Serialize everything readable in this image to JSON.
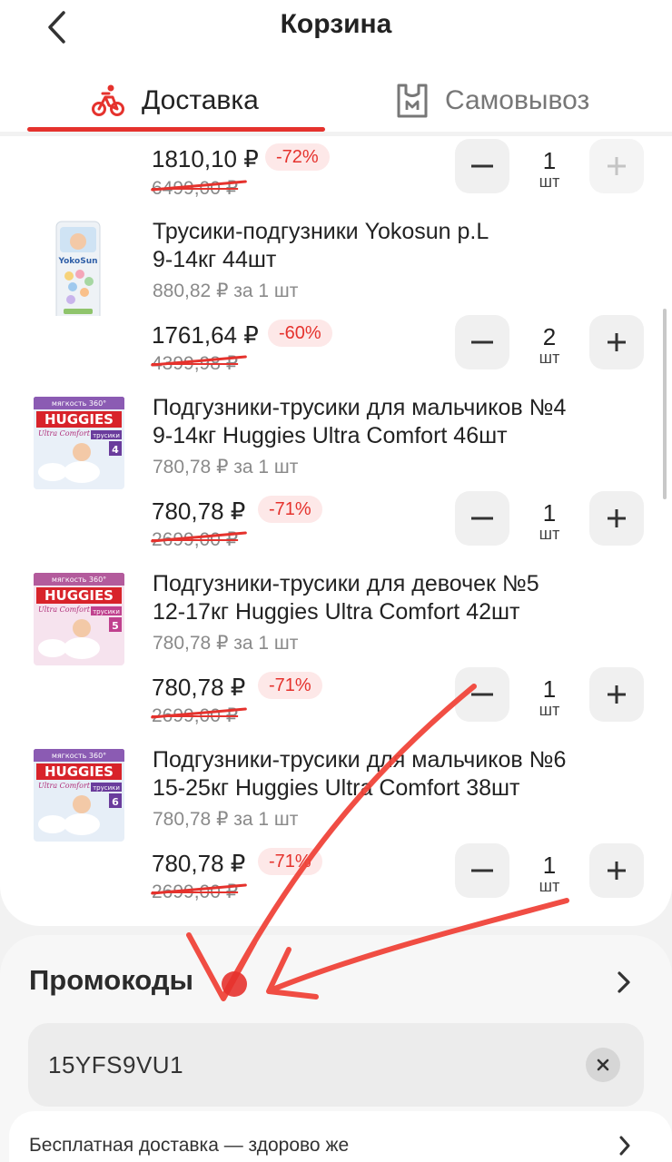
{
  "header": {
    "title": "Корзина",
    "tabs": [
      {
        "label": "Доставка",
        "active": true,
        "icon": "bike-delivery-icon"
      },
      {
        "label": "Самовывоз",
        "active": false,
        "icon": "pickup-bag-icon"
      }
    ]
  },
  "cart": {
    "items": [
      {
        "title": "",
        "unit_price": "",
        "price": "1810,10 ₽",
        "discount": "-72%",
        "old_price": "6499,00 ₽",
        "qty": "1",
        "unit": "шт",
        "plus_disabled": true
      },
      {
        "title_line1": "Трусики-подгузники Yokosun p.L",
        "title_line2": "9-14кг 44шт",
        "unit_price": "880,82 ₽ за 1 шт",
        "price": "1761,64 ₽",
        "discount": "-60%",
        "old_price": "4399,98 ₽",
        "qty": "2",
        "unit": "шт",
        "image": "yokosun-pack"
      },
      {
        "title_line1": "Подгузники-трусики для мальчиков №4",
        "title_line2": "9-14кг Huggies Ultra Comfort 46шт",
        "unit_price": "780,78 ₽ за 1 шт",
        "price": "780,78 ₽",
        "discount": "-71%",
        "old_price": "2699,00 ₽",
        "qty": "1",
        "unit": "шт",
        "image": "huggies-4-pack",
        "pack_size": "4"
      },
      {
        "title_line1": "Подгузники-трусики для девочек №5",
        "title_line2": "12-17кг Huggies Ultra Comfort 42шт",
        "unit_price": "780,78 ₽ за 1 шт",
        "price": "780,78 ₽",
        "discount": "-71%",
        "old_price": "2699,00 ₽",
        "qty": "1",
        "unit": "шт",
        "image": "huggies-5-pack",
        "pack_size": "5"
      },
      {
        "title_line1": "Подгузники-трусики для мальчиков №6",
        "title_line2": "15-25кг Huggies Ultra Comfort 38шт",
        "unit_price": "780,78 ₽ за 1 шт",
        "price": "780,78 ₽",
        "discount": "-71%",
        "old_price": "2699,00 ₽",
        "qty": "1",
        "unit": "шт",
        "image": "huggies-6-pack",
        "pack_size": "6"
      }
    ]
  },
  "promo": {
    "title": "Промокоды",
    "code": "15YFS9VU1",
    "free_delivery_text": "Бесплатная доставка — здорово же"
  },
  "package_labels": {
    "brand": "HUGGIES",
    "line": "Ultra Comfort",
    "top": "мягкость 360°",
    "type": "трусики",
    "yokosun": "YokoSun"
  },
  "colors": {
    "accent": "#e5322d",
    "discount_bg": "#fde8e8",
    "qty_bg": "#f0f0f0",
    "huggies_red": "#d8232a",
    "annotation_arrow": "#f0443a"
  }
}
